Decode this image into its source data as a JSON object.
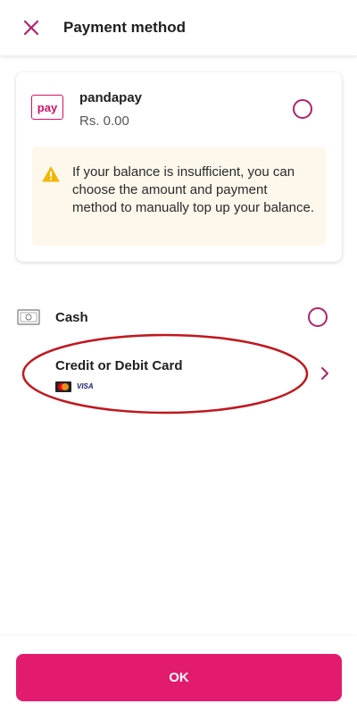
{
  "header": {
    "title": "Payment method",
    "close_icon": "close-icon"
  },
  "pandapay": {
    "logo_text": "pay",
    "name": "pandapay",
    "balance": "Rs. 0.00",
    "notice": "If your balance is insufficient, you can choose the amount and payment method to manually top up your balance."
  },
  "methods": {
    "cash_label": "Cash",
    "card_label": "Credit or Debit Card",
    "card_brands": [
      "mastercard",
      "VISA"
    ]
  },
  "footer": {
    "ok_label": "OK"
  },
  "colors": {
    "brand": "#e21b6e",
    "radio": "#b0236a",
    "notice_bg": "#fef8ec",
    "annotation": "#c0181e"
  }
}
